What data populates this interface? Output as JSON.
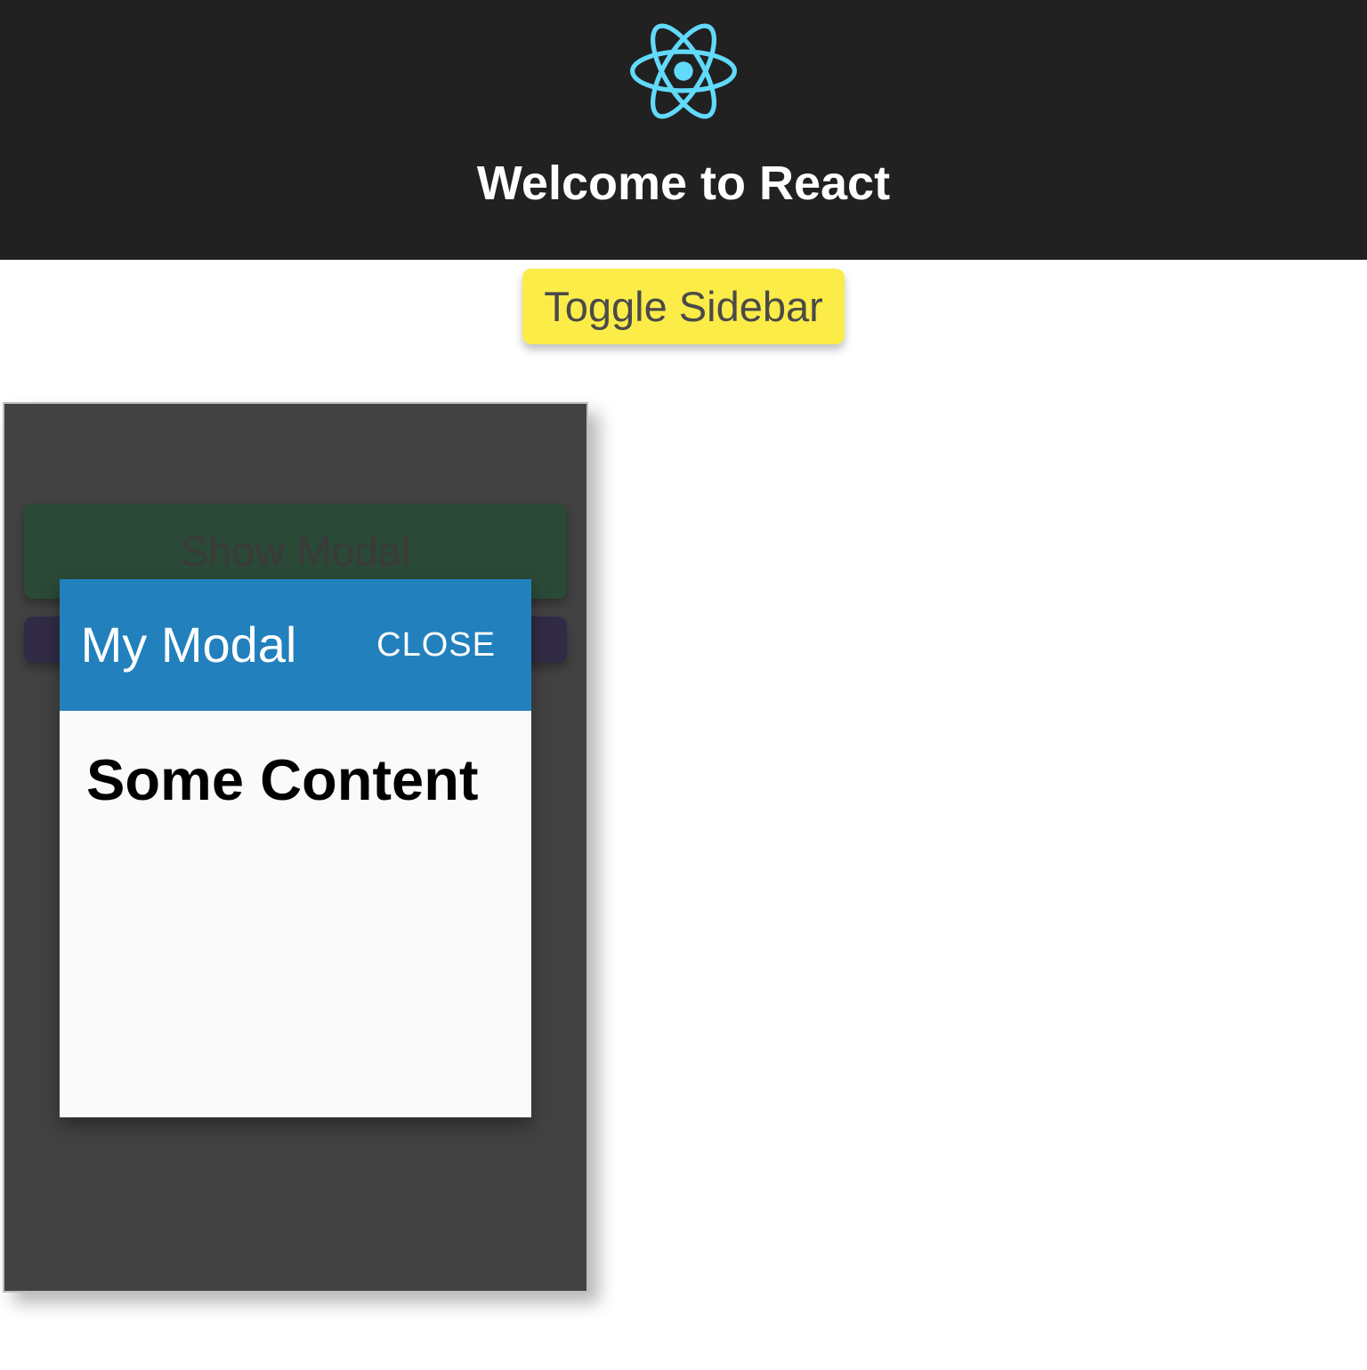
{
  "header": {
    "title": "Welcome to React",
    "logo": "react-logo"
  },
  "toggle": {
    "label": "Toggle Sidebar"
  },
  "sidebar": {
    "buttons": [
      {
        "label": "Show Modal"
      },
      {
        "label": ""
      }
    ]
  },
  "modal": {
    "title": "My Modal",
    "close_label": "CLOSE",
    "content_heading": "Some Content"
  },
  "colors": {
    "header_bg": "#212121",
    "toggle_bg": "#fcec48",
    "sidebar_bg": "#424242",
    "modal_header_bg": "#2280bd",
    "modal_body_bg": "#fafafa",
    "react_logo": "#61dafb"
  }
}
